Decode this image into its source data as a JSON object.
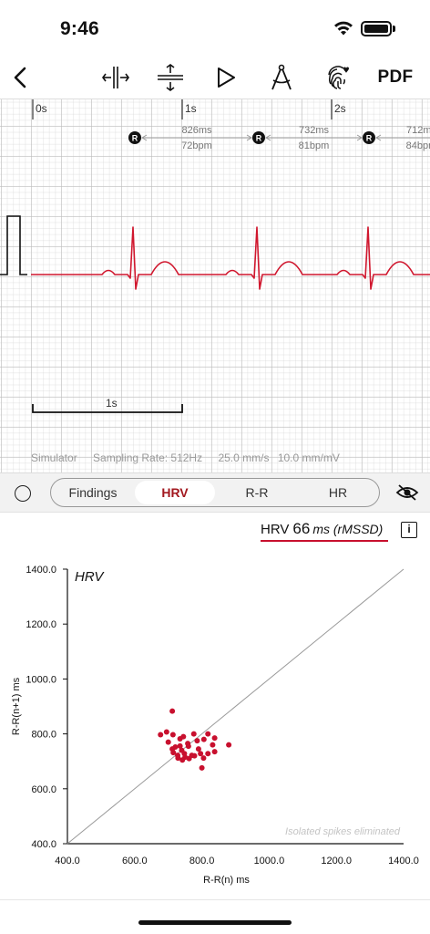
{
  "status_bar": {
    "time": "9:46"
  },
  "toolbar": {
    "pdf_label": "PDF"
  },
  "ecg": {
    "time_ticks": [
      "0s",
      "1s",
      "2s"
    ],
    "rr_intervals": [
      {
        "ms": "826ms",
        "bpm": "72bpm"
      },
      {
        "ms": "732ms",
        "bpm": "81bpm"
      },
      {
        "ms": "712ms",
        "bpm": "84bpm"
      }
    ],
    "r_marker": "R",
    "scale_label": "1s",
    "footer": {
      "source": "Simulator",
      "sampling_rate": "Sampling Rate: 512Hz",
      "paper_speed": "25.0 mm/s",
      "gain": "10.0 mm/mV"
    },
    "trace_color": "#d0172e"
  },
  "tabs": {
    "items": [
      "Findings",
      "HRV",
      "R-R",
      "HR"
    ],
    "active": "HRV"
  },
  "hrv": {
    "label": "HRV",
    "value": "66",
    "unit": "ms (rMSSD)",
    "info": "i"
  },
  "chart_data": {
    "type": "scatter",
    "title": "HRV",
    "xlabel": "R-R(n) ms",
    "ylabel": "R-R(n+1) ms",
    "xlim": [
      400,
      1400
    ],
    "ylim": [
      400,
      1400
    ],
    "x_ticks": [
      "400.0",
      "600.0",
      "800.0",
      "1000.0",
      "1200.0",
      "1400.0"
    ],
    "y_ticks": [
      "400.0",
      "600.0",
      "800.0",
      "1000.0",
      "1200.0",
      "1400.0"
    ],
    "identity_line": true,
    "annotation": "Isolated spikes eliminated",
    "point_color": "#c8102e",
    "points": [
      {
        "x": 712,
        "y": 883
      },
      {
        "x": 677,
        "y": 797
      },
      {
        "x": 695,
        "y": 807
      },
      {
        "x": 714,
        "y": 797
      },
      {
        "x": 745,
        "y": 790
      },
      {
        "x": 776,
        "y": 800
      },
      {
        "x": 818,
        "y": 800
      },
      {
        "x": 838,
        "y": 785
      },
      {
        "x": 880,
        "y": 760
      },
      {
        "x": 735,
        "y": 782
      },
      {
        "x": 758,
        "y": 765
      },
      {
        "x": 786,
        "y": 775
      },
      {
        "x": 806,
        "y": 780
      },
      {
        "x": 721,
        "y": 752
      },
      {
        "x": 740,
        "y": 740
      },
      {
        "x": 760,
        "y": 755
      },
      {
        "x": 790,
        "y": 745
      },
      {
        "x": 832,
        "y": 760
      },
      {
        "x": 715,
        "y": 732
      },
      {
        "x": 728,
        "y": 722
      },
      {
        "x": 748,
        "y": 728
      },
      {
        "x": 770,
        "y": 722
      },
      {
        "x": 796,
        "y": 728
      },
      {
        "x": 818,
        "y": 728
      },
      {
        "x": 838,
        "y": 735
      },
      {
        "x": 729,
        "y": 712
      },
      {
        "x": 750,
        "y": 715
      },
      {
        "x": 778,
        "y": 720
      },
      {
        "x": 805,
        "y": 712
      },
      {
        "x": 742,
        "y": 705
      },
      {
        "x": 762,
        "y": 710
      },
      {
        "x": 712,
        "y": 745
      },
      {
        "x": 735,
        "y": 756
      },
      {
        "x": 800,
        "y": 676
      },
      {
        "x": 700,
        "y": 770
      }
    ]
  }
}
